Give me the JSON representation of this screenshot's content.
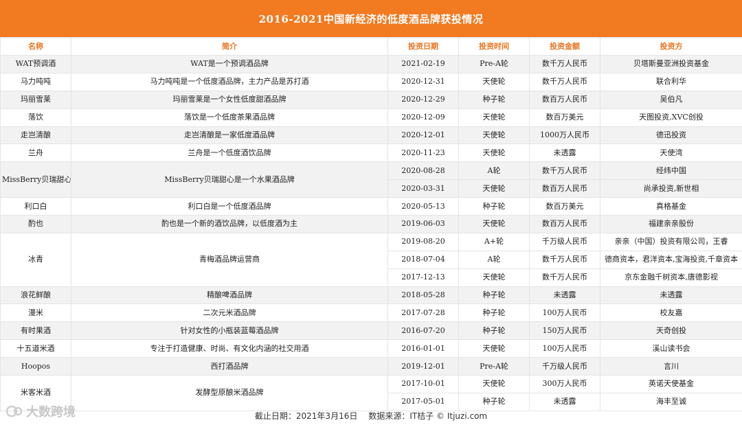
{
  "title": "2016-2021中国新经济的低度酒品牌获投情况",
  "headers": {
    "name": "名称",
    "intro": "简介",
    "date": "投资日期",
    "round": "投资时间",
    "amount": "投资金额",
    "investor": "投资方"
  },
  "rows": [
    {
      "name": "WAT预调酒",
      "intro": "WAT是一个预调酒品牌",
      "deals": [
        {
          "date": "2021-02-19",
          "round": "Pre-A轮",
          "amount": "数千万人民币",
          "investor": "贝塔斯曼亚洲投资基金"
        }
      ]
    },
    {
      "name": "马力吨吨",
      "intro": "马力吨吨是一个低度酒品牌，主力产品是苏打酒",
      "deals": [
        {
          "date": "2020-12-31",
          "round": "天使轮",
          "amount": "数千万人民币",
          "investor": "联合利华"
        }
      ]
    },
    {
      "name": "玛丽雪莱",
      "intro": "玛丽雪莱是一个女性低度甜酒品牌",
      "deals": [
        {
          "date": "2020-12-29",
          "round": "种子轮",
          "amount": "数百万人民币",
          "investor": "吴伯凡"
        }
      ]
    },
    {
      "name": "落饮",
      "intro": "落饮是一个低度茶果酒品牌",
      "deals": [
        {
          "date": "2020-12-09",
          "round": "天使轮",
          "amount": "数百万美元",
          "investor": "天图投资,XVC创投"
        }
      ]
    },
    {
      "name": "走岂清酿",
      "intro": "走岂清酿是一家低度酒品牌",
      "deals": [
        {
          "date": "2020-12-01",
          "round": "天使轮",
          "amount": "1000万人民币",
          "investor": "德迅投资"
        }
      ]
    },
    {
      "name": "兰舟",
      "intro": "兰舟是一个低度酒饮品牌",
      "deals": [
        {
          "date": "2020-11-23",
          "round": "天使轮",
          "amount": "未透露",
          "investor": "天使湾"
        }
      ]
    },
    {
      "name": "MissBerry贝瑞甜心",
      "intro": "MissBerry贝瑞甜心是一个水果酒品牌",
      "deals": [
        {
          "date": "2020-08-28",
          "round": "A轮",
          "amount": "数千万人民币",
          "investor": "经纬中国"
        },
        {
          "date": "2020-03-31",
          "round": "天使轮",
          "amount": "数百万人民币",
          "investor": "尚承投资,新世相"
        }
      ]
    },
    {
      "name": "利口白",
      "intro": "利口白是一个低度酒品牌",
      "deals": [
        {
          "date": "2020-05-13",
          "round": "种子轮",
          "amount": "数百万美元",
          "investor": "真格基金"
        }
      ]
    },
    {
      "name": "酌也",
      "intro": "酌也是一个新的酒饮品牌，以低度酒为主",
      "deals": [
        {
          "date": "2019-06-03",
          "round": "天使轮",
          "amount": "数百万人民币",
          "investor": "福建亲亲股份"
        }
      ]
    },
    {
      "name": "冰青",
      "intro": "青梅酒品牌运营商",
      "deals": [
        {
          "date": "2019-08-20",
          "round": "A+轮",
          "amount": "千万级人民币",
          "investor": "亲亲（中国）投资有限公司，王睿"
        },
        {
          "date": "2018-07-04",
          "round": "A轮",
          "amount": "数千万人民币",
          "investor": "德商资本，君洋资本,宝海投资,千章资本"
        },
        {
          "date": "2017-12-13",
          "round": "天使轮",
          "amount": "数千万人民币",
          "investor": "京东金融千树资本,唐德影视"
        }
      ]
    },
    {
      "name": "浪花鲜酿",
      "intro": "精酿啤酒品牌",
      "deals": [
        {
          "date": "2018-05-28",
          "round": "种子轮",
          "amount": "未透露",
          "investor": "未透露"
        }
      ]
    },
    {
      "name": "漫米",
      "intro": "二次元米酒品牌",
      "deals": [
        {
          "date": "2017-07-28",
          "round": "种子轮",
          "amount": "100万人民币",
          "investor": "校友嘉"
        }
      ]
    },
    {
      "name": "有时果酒",
      "intro": "针对女性的小瓶装蓝莓酒品牌",
      "deals": [
        {
          "date": "2016-07-20",
          "round": "种子轮",
          "amount": "150万人民币",
          "investor": "天奇创投"
        }
      ]
    },
    {
      "name": "十五道米酒",
      "intro": "专注于打造健康、时尚、有文化内涵的社交用酒",
      "deals": [
        {
          "date": "2016-01-01",
          "round": "天使轮",
          "amount": "100万人民币",
          "investor": "溪山读书会"
        }
      ]
    },
    {
      "name": "Hoopos",
      "intro": "西打酒品牌",
      "deals": [
        {
          "date": "2019-12-01",
          "round": "Pre-A轮",
          "amount": "千万级人民币",
          "investor": "言川"
        }
      ]
    },
    {
      "name": "米客米酒",
      "intro": "发酵型原酿米酒品牌",
      "deals": [
        {
          "date": "2017-10-01",
          "round": "天使轮",
          "amount": "300万人民币",
          "investor": "英诺天使基金"
        },
        {
          "date": "2017-05-01",
          "round": "种子轮",
          "amount": "未透露",
          "investor": "海丰至诚"
        }
      ]
    }
  ],
  "footer": {
    "cutoff": "截止日期：2021年3月16日",
    "source": "数据来源：IT桔子 © Itjuzi.com"
  },
  "watermark": "大数跨境",
  "colors": {
    "accent": "#f27a21",
    "header_text": "#e8731d"
  }
}
